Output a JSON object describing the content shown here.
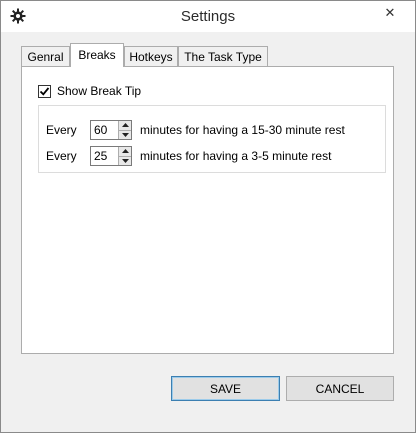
{
  "window": {
    "title": "Settings",
    "icons": {
      "app": "gear-icon",
      "close": "close-icon"
    }
  },
  "tabs": [
    {
      "label": "Genral",
      "active": false
    },
    {
      "label": "Breaks",
      "active": true
    },
    {
      "label": "Hotkeys",
      "active": false
    },
    {
      "label": "The Task Type",
      "active": false
    }
  ],
  "breaks": {
    "show_break_tip": {
      "label": "Show Break Tip",
      "checked": true
    },
    "rows": [
      {
        "prefix": "Every",
        "value": "60",
        "suffix": "minutes for having a 15-30 minute rest"
      },
      {
        "prefix": "Every",
        "value": "25",
        "suffix": "minutes for having a 3-5 minute rest"
      }
    ]
  },
  "buttons": {
    "save": "SAVE",
    "cancel": "CANCEL"
  }
}
